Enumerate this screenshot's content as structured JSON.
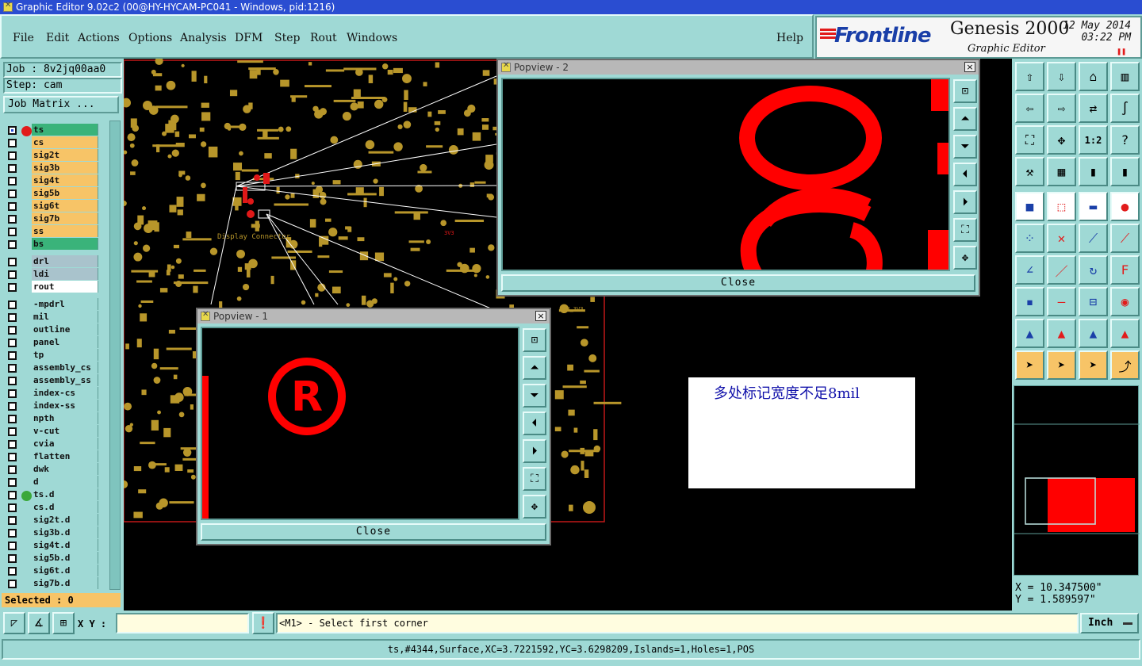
{
  "window": {
    "title": "Graphic Editor 9.02c2 (00@HY-HYCAM-PC041 - Windows, pid:1216)"
  },
  "menu": [
    {
      "label": "File"
    },
    {
      "label": "Edit"
    },
    {
      "label": "Actions"
    },
    {
      "label": "Options"
    },
    {
      "label": "Analysis"
    },
    {
      "label": "DFM"
    },
    {
      "label": "Step"
    },
    {
      "label": "Rout"
    },
    {
      "label": "Windows"
    }
  ],
  "help_label": "Help",
  "brand": {
    "logo": "Frontline",
    "product": "Genesis 2000",
    "subtitle": "Graphic Editor",
    "date": "12 May 2014",
    "time": "03:22 PM",
    "accent": "#e21b1b",
    "logo_color": "#1a3fa8"
  },
  "job": {
    "job_label": "Job : 8v2jq00aa0",
    "step_label": "Step: cam",
    "matrix_button": "Job Matrix ..."
  },
  "layers": [
    {
      "name": "ts",
      "color": "#3ab37a",
      "dot": "#e21b1b",
      "checked": true
    },
    {
      "name": "cs",
      "color": "#f7c467"
    },
    {
      "name": "sig2t",
      "color": "#f7c467"
    },
    {
      "name": "sig3b",
      "color": "#f7c467"
    },
    {
      "name": "sig4t",
      "color": "#f7c467"
    },
    {
      "name": "sig5b",
      "color": "#f7c467"
    },
    {
      "name": "sig6t",
      "color": "#f7c467"
    },
    {
      "name": "sig7b",
      "color": "#f7c467"
    },
    {
      "name": "ss",
      "color": "#f7c467"
    },
    {
      "name": "bs",
      "color": "#3ab37a"
    },
    {
      "name": "drl",
      "color": "#a9c3cc"
    },
    {
      "name": "ldi",
      "color": "#a9c3cc"
    },
    {
      "name": "rout",
      "color": "#ffffff"
    },
    {
      "name": "-mpdrl",
      "color": "#9fd9d5"
    },
    {
      "name": "mil",
      "color": "#9fd9d5"
    },
    {
      "name": "outline",
      "color": "#9fd9d5"
    },
    {
      "name": "panel",
      "color": "#9fd9d5"
    },
    {
      "name": "tp",
      "color": "#9fd9d5"
    },
    {
      "name": "assembly_cs",
      "color": "#9fd9d5"
    },
    {
      "name": "assembly_ss",
      "color": "#9fd9d5"
    },
    {
      "name": "index-cs",
      "color": "#9fd9d5"
    },
    {
      "name": "index-ss",
      "color": "#9fd9d5"
    },
    {
      "name": "npth",
      "color": "#9fd9d5"
    },
    {
      "name": "v-cut",
      "color": "#9fd9d5"
    },
    {
      "name": "cvia",
      "color": "#9fd9d5"
    },
    {
      "name": "flatten",
      "color": "#9fd9d5"
    },
    {
      "name": "dwk",
      "color": "#9fd9d5"
    },
    {
      "name": "d",
      "color": "#9fd9d5"
    },
    {
      "name": "ts.d",
      "color": "#9fd9d5",
      "dot": "#3aa83a"
    },
    {
      "name": "cs.d",
      "color": "#9fd9d5"
    },
    {
      "name": "sig2t.d",
      "color": "#9fd9d5"
    },
    {
      "name": "sig3b.d",
      "color": "#9fd9d5"
    },
    {
      "name": "sig4t.d",
      "color": "#9fd9d5"
    },
    {
      "name": "sig5b.d",
      "color": "#9fd9d5"
    },
    {
      "name": "sig6t.d",
      "color": "#9fd9d5"
    },
    {
      "name": "sig7b.d",
      "color": "#9fd9d5"
    }
  ],
  "selected_label": "Selected : 0",
  "popview1": {
    "title": "Popview - 1",
    "close": "Close",
    "content": "R"
  },
  "popview2": {
    "title": "Popview - 2",
    "close": "Close",
    "content": "60"
  },
  "canvas": {
    "connector_label": "Display Connector",
    "net_label_1": "NCU_3V3",
    "net_label_2": "3V3",
    "pad_color": "#b8962a",
    "feature_color": "#ff0000"
  },
  "note": "多处标记宽度不足8mil",
  "coords": {
    "x": "X = 10.347500\"",
    "y": "Y = 1.589597\""
  },
  "bottom": {
    "xy_label": "X Y :",
    "xy_value": "",
    "message": "<M1> - Select first corner",
    "unit": "Inch"
  },
  "status": "ts,#4344,Surface,XC=3.7221592,YC=3.6298209,Islands=1,Holes=1,POS",
  "toolbar_icons": [
    "home-up-icon",
    "home-down-icon",
    "house-icon",
    "window-split-icon",
    "pan-left-icon",
    "pan-right-icon",
    "swap-icon",
    "s-curve-icon",
    "zoom-fit-icon",
    "zoom-center-icon",
    "scale-1-2-icon",
    "help-query-icon",
    "tools-icon",
    "grid-icon",
    "layers-color-icon",
    "layers-red-icon",
    "white-box-icon",
    "sketch-icon",
    "ruler-icon",
    "circle-icon",
    "nodes-icon",
    "cross-icon",
    "connect-icon",
    "connect-alt-icon",
    "line-red-icon",
    "line-blue-icon",
    "arc-icon",
    "text-f-icon",
    "point-icon",
    "line-seg-icon",
    "measure-icon",
    "group-icon",
    "triangle-icon",
    "triangle-a-icon",
    "triangle-b-icon",
    "triangle-c-icon",
    "pointer-icon",
    "pointer-box-icon",
    "pointer-select-icon",
    "path-icon"
  ],
  "scale_label": "1:2"
}
